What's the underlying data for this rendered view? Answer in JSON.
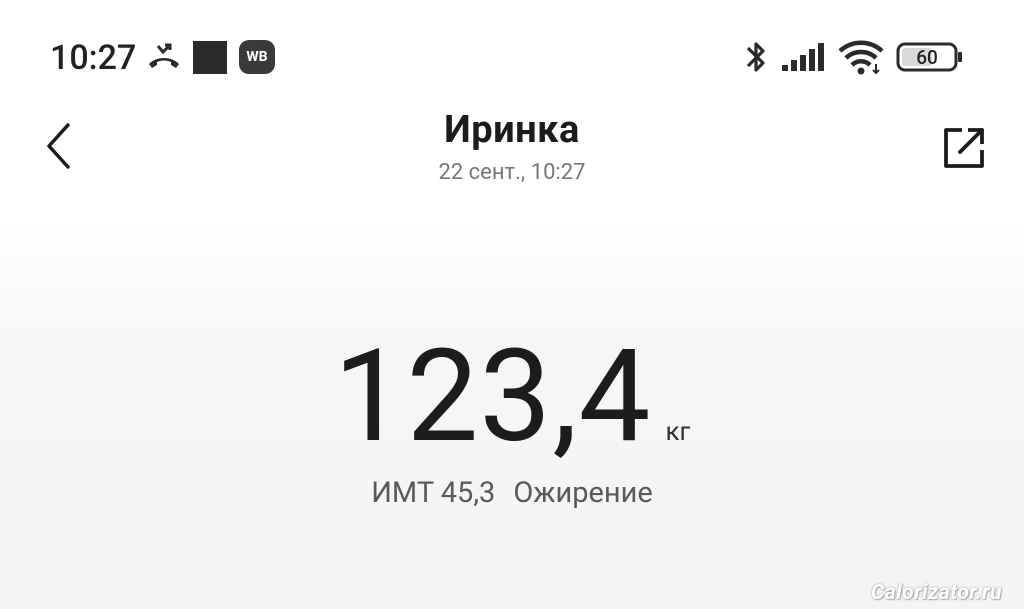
{
  "status_bar": {
    "time": "10:27",
    "wb_badge": "WB",
    "battery": "60",
    "icons": [
      "missed-call-icon",
      "notification-square-icon",
      "wb-app-icon",
      "bluetooth-icon",
      "signal-icon",
      "wifi-icon",
      "battery-icon"
    ]
  },
  "header": {
    "title": "Иринка",
    "subtitle": "22 сент., 10:27",
    "back_icon": "chevron-left-icon",
    "share_icon": "share-external-icon"
  },
  "measurement": {
    "weight": "123,4",
    "unit": "кг",
    "bmi_label": "ИМТ 45,3",
    "bmi_status": "Ожирение"
  },
  "watermark": "Calorizator.ru"
}
